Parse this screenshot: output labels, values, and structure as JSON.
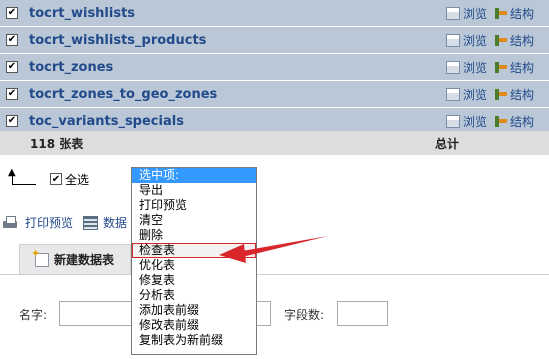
{
  "tables": [
    {
      "name": "tocrt_wishlists",
      "checked": true
    },
    {
      "name": "tocrt_wishlists_products",
      "checked": true
    },
    {
      "name": "tocrt_zones",
      "checked": true
    },
    {
      "name": "tocrt_zones_to_geo_zones",
      "checked": true
    },
    {
      "name": "toc_variants_specials",
      "checked": true
    }
  ],
  "row_actions": {
    "browse": "浏览",
    "structure": "结构"
  },
  "summary": {
    "count": "118 张表",
    "total": "总计"
  },
  "select_all": {
    "label": "全选",
    "checked": true
  },
  "print_bar": {
    "print_preview": "打印预览",
    "data_dict": "数据"
  },
  "new_table": {
    "label": "新建数据表"
  },
  "form": {
    "name_label": "名字:",
    "fields_label": "字段数:"
  },
  "dropdown": {
    "items": [
      "选中项:",
      "导出",
      "打印预览",
      "清空",
      "删除",
      "检查表",
      "优化表",
      "修复表",
      "分析表",
      "添加表前缀",
      "修改表前缀",
      "复制表为新前缀"
    ],
    "selected_index": 0,
    "highlight_index": 5
  },
  "colors": {
    "row_bg": "#b9c7d6",
    "link": "#234a8b",
    "selected": "#3399ff",
    "annotation": "#d8262b"
  }
}
